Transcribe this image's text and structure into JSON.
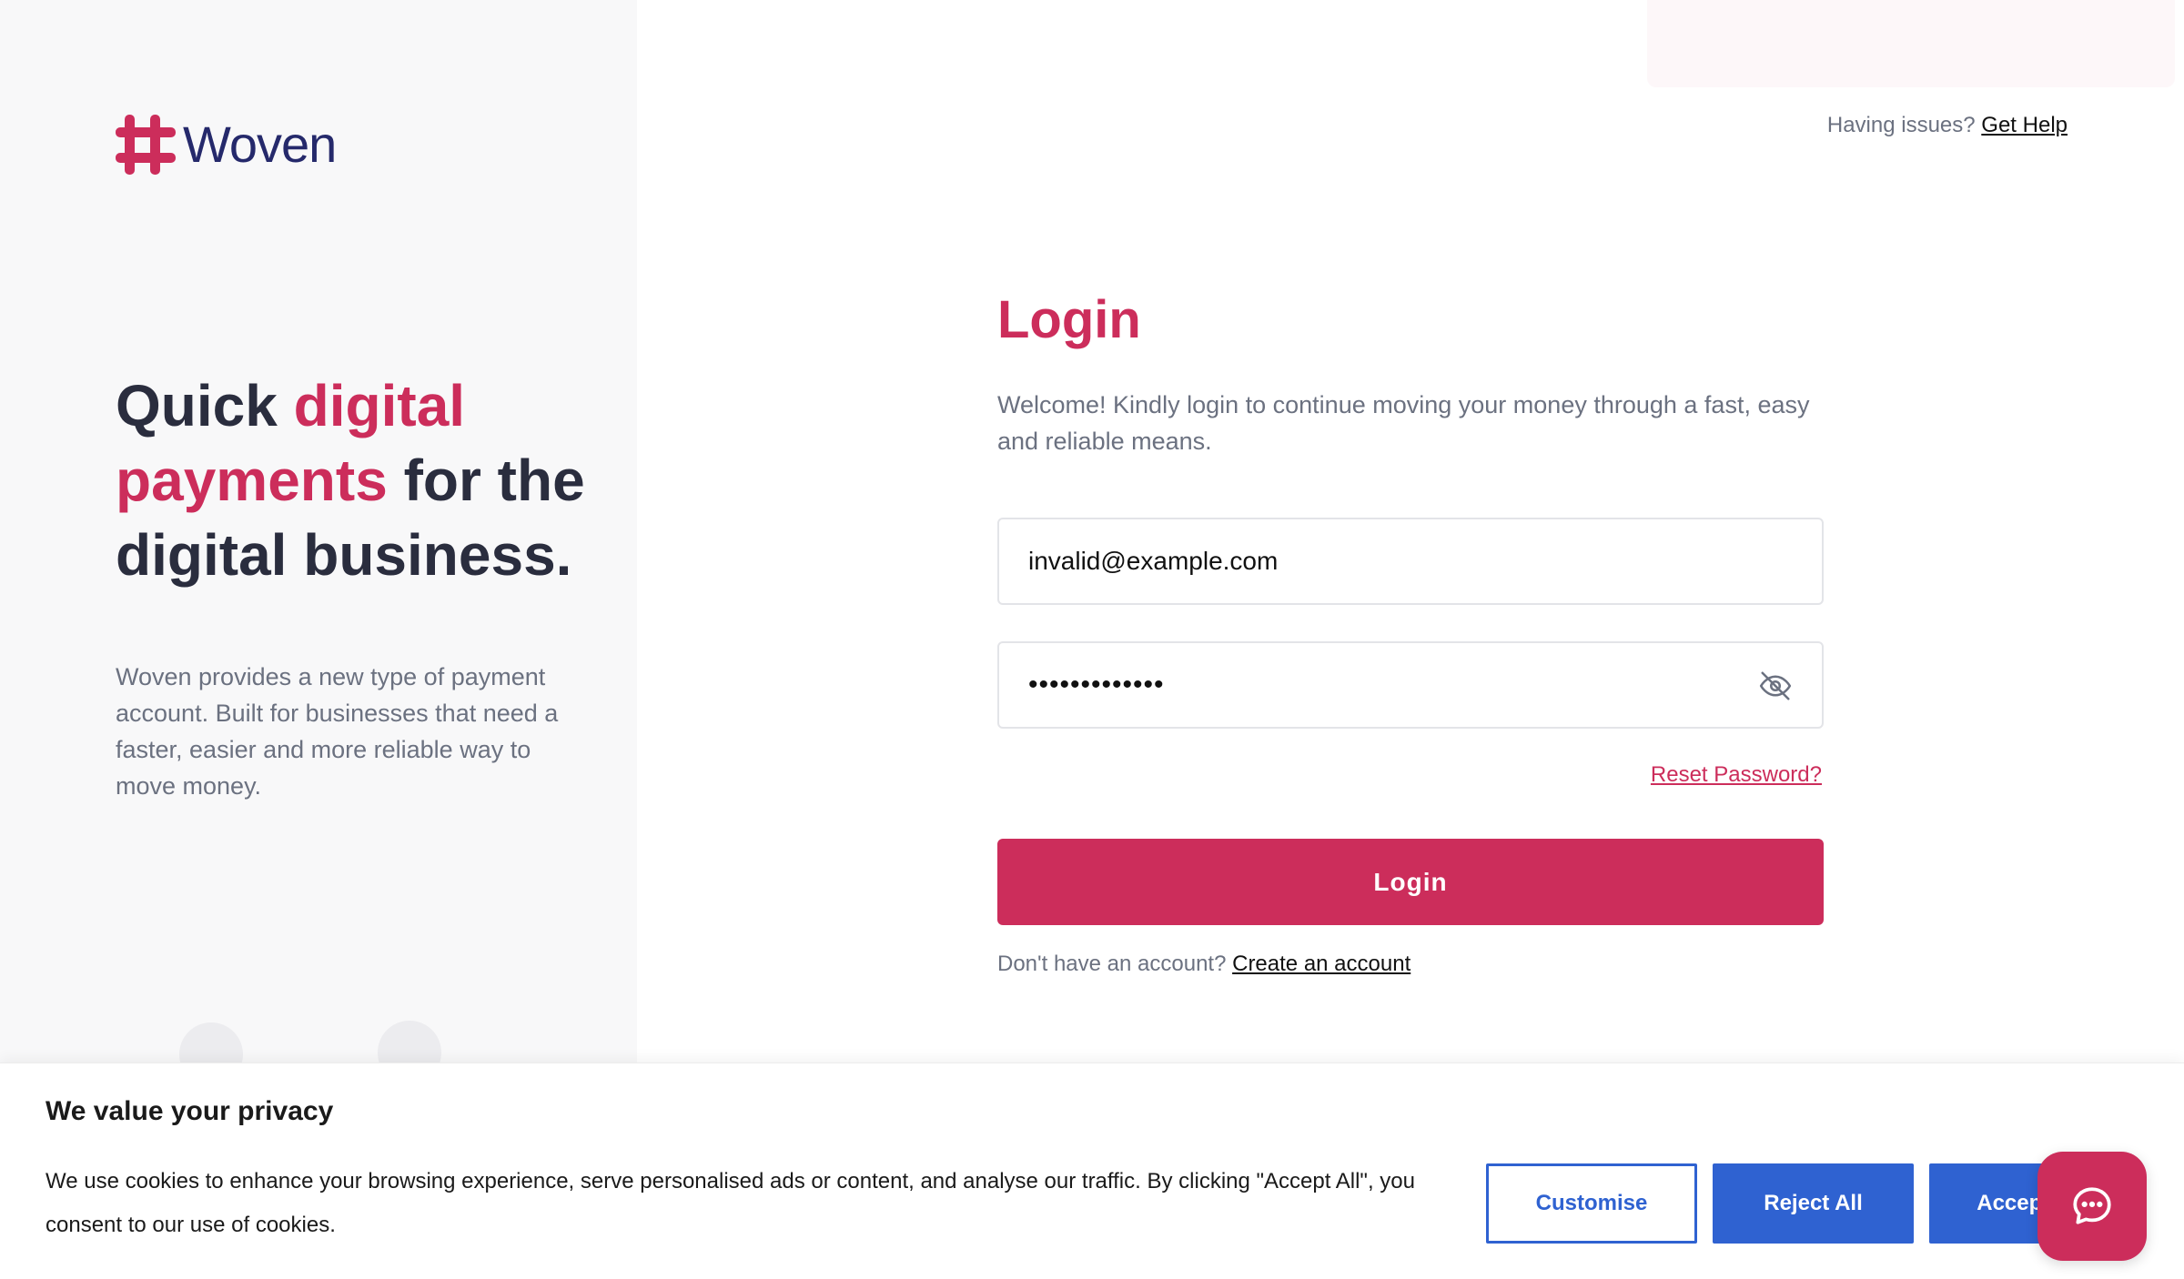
{
  "brand": {
    "name": "Woven",
    "accent_color": "#cc2d5b",
    "dark_color": "#25296b"
  },
  "hero": {
    "headline_part1": "Quick ",
    "headline_accent": "digital payments",
    "headline_part2": " for the digital business.",
    "description": "Woven provides a new type of payment account. Built for businesses that need a faster, easier and more reliable way to move money."
  },
  "header": {
    "help_prompt": "Having issues?",
    "help_link": "Get Help"
  },
  "login": {
    "title": "Login",
    "welcome": "Welcome! Kindly login to continue moving your money through a fast, easy and reliable means.",
    "email_value": "invalid@example.com",
    "password_value": "•••••••••••••",
    "password_toggle_icon": "eye-slash-icon",
    "reset_link": "Reset Password?",
    "submit_label": "Login",
    "signup_prompt": "Don't have an account?",
    "signup_link": "Create an account"
  },
  "cookie_banner": {
    "title": "We value your privacy",
    "text": "We use cookies to enhance your browsing experience, serve personalised ads or content, and analyse our traffic. By clicking \"Accept All\", you consent to our use of cookies.",
    "customise_label": "Customise",
    "reject_label": "Reject All",
    "accept_label": "Accept All",
    "button_color": "#2f62d1"
  },
  "chat": {
    "icon": "chat-bubble-icon"
  }
}
